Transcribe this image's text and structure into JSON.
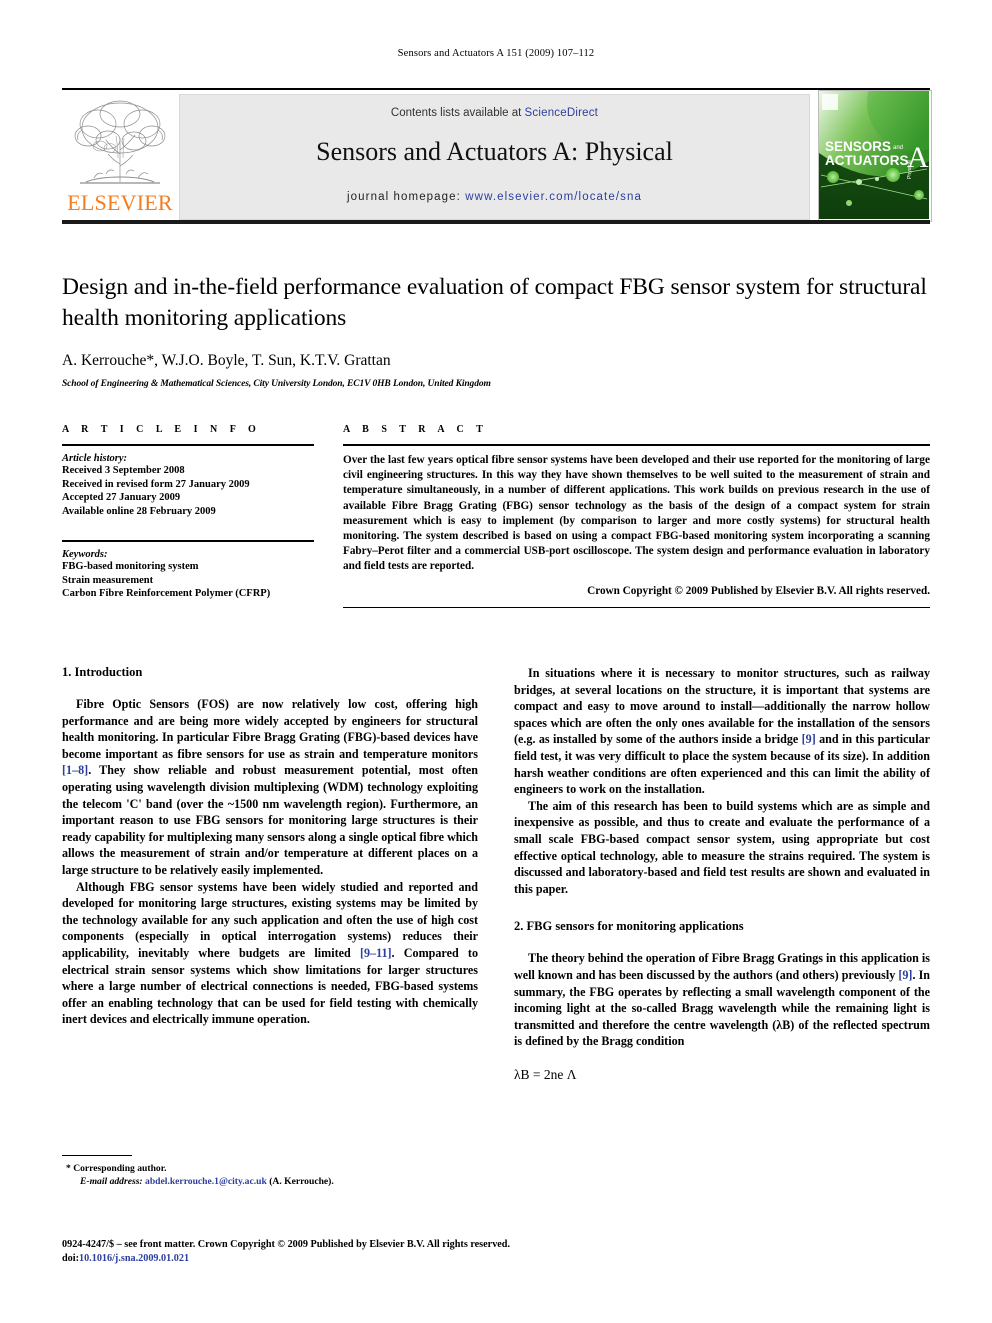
{
  "running_head": "Sensors and Actuators A 151 (2009) 107–112",
  "masthead": {
    "publisher_name": "ELSEVIER",
    "contents_prefix": "Contents lists available at ",
    "contents_link": "ScienceDirect",
    "journal_title": "Sensors and Actuators A: Physical",
    "homepage_prefix": "journal homepage: ",
    "homepage_url": "www.elsevier.com/locate/sna",
    "cover": {
      "line1": "SENSORS",
      "line1_suffix": "and",
      "line2": "ACTUATORS",
      "letter": "A",
      "sub": "Physical"
    },
    "colors": {
      "elsevier_orange": "#F47C20",
      "link_blue": "#2c3e9e",
      "band_grey": "#e9e9e9",
      "cover_green": "#3faa35"
    }
  },
  "title": "Design and in-the-field performance evaluation of compact FBG sensor system for structural health monitoring applications",
  "authors": "A. Kerrouche*, W.J.O. Boyle, T. Sun, K.T.V. Grattan",
  "affiliation": "School of Engineering & Mathematical Sciences, City University London, EC1V 0HB London, United Kingdom",
  "article_info": {
    "label": "A R T I C L E   I N F O",
    "history_label": "Article history:",
    "history": [
      "Received 3 September 2008",
      "Received in revised form 27 January 2009",
      "Accepted 27 January 2009",
      "Available online 28 February 2009"
    ],
    "keywords_label": "Keywords:",
    "keywords": [
      "FBG-based monitoring system",
      "Strain measurement",
      "Carbon Fibre Reinforcement Polymer (CFRP)"
    ]
  },
  "abstract": {
    "label": "A B S T R A C T",
    "text": "Over the last few years optical fibre sensor systems have been developed and their use reported for the monitoring of large civil engineering structures. In this way they have shown themselves to be well suited to the measurement of strain and temperature simultaneously, in a number of different applications. This work builds on previous research in the use of available Fibre Bragg Grating (FBG) sensor technology as the basis of the design of a compact system for strain measurement which is easy to implement (by comparison to larger and more costly systems) for structural health monitoring. The system described is based on using a compact FBG-based monitoring system incorporating a scanning Fabry–Perot filter and a commercial USB-port oscilloscope. The system design and performance evaluation in laboratory and field tests are reported.",
    "copyright": "Crown Copyright © 2009 Published by Elsevier B.V. All rights reserved."
  },
  "sections": {
    "intro_heading": "1.  Introduction",
    "intro_p1_a": "Fibre Optic Sensors (FOS) are now relatively low cost, offering high performance and are being more widely accepted by engineers for structural health monitoring. In particular Fibre Bragg Grating (FBG)-based devices have become important as fibre sensors for use as strain and temperature monitors ",
    "intro_p1_ref": "[1–8]",
    "intro_p1_b": ". They show reliable and robust measurement potential, most often operating using wavelength division multiplexing (WDM) technology exploiting the telecom 'C' band (over the ~1500 nm wavelength region). Furthermore, an important reason to use FBG sensors for monitoring large structures is their ready capability for multiplexing many sensors along a single optical fibre which allows the measurement of strain and/or temperature at different places on a large structure to be relatively easily implemented.",
    "intro_p2_a": "Although FBG sensor systems have been widely studied and reported and developed for monitoring large structures, existing systems may be limited by the technology available for any such application and often the use of high cost components (especially in optical interrogation systems) reduces their applicability, inevitably where budgets are limited ",
    "intro_p2_ref": "[9–11]",
    "intro_p2_b": ". Compared to electrical strain sensor systems which show limitations for larger structures where a large number of electrical connections is needed, FBG-based systems offer an enabling technology that can be used for field testing with chemically inert devices and electrically immune operation.",
    "intro_p3_a": "In situations where it is necessary to monitor structures, such as railway bridges, at several locations on the structure, it is important that systems are compact and easy to move around to install—additionally the narrow hollow spaces which are often the only ones available for the installation of the sensors (e.g. as installed by some of the authors inside a bridge ",
    "intro_p3_ref": "[9]",
    "intro_p3_b": " and in this particular field test, it was very difficult to place the system because of its size). In addition harsh weather conditions are often experienced and this can limit the ability of engineers to work on the installation.",
    "intro_p4": "The aim of this research has been to build systems which are as simple and inexpensive as possible, and thus to create and evaluate the performance of a small scale FBG-based compact sensor system, using appropriate but cost effective optical technology, able to measure the strains required. The system is discussed and laboratory-based and field test results are shown and evaluated in this paper.",
    "fbg_heading": "2.  FBG sensors for monitoring applications",
    "fbg_p1_a": "The theory behind the operation of Fibre Bragg Gratings in this application is well known and has been discussed by the authors (and others) previously ",
    "fbg_p1_ref": "[9]",
    "fbg_p1_b": ". In summary, the FBG operates by reflecting a small wavelength component of the incoming light at the so-called Bragg wavelength while the remaining light is transmitted and therefore the centre wavelength (λB) of the reflected spectrum is defined by the Bragg condition",
    "equation": "λB = 2ne Λ"
  },
  "footnote": {
    "corresponding": "*  Corresponding author.",
    "email_label": "E-mail address:",
    "email": "abdel.kerrouche.1@city.ac.uk",
    "email_who": "(A. Kerrouche)."
  },
  "footer": {
    "issn_line": "0924-4247/$ – see front matter. Crown Copyright © 2009 Published by Elsevier B.V. All rights reserved.",
    "doi_label": "doi:",
    "doi": "10.1016/j.sna.2009.01.021"
  }
}
